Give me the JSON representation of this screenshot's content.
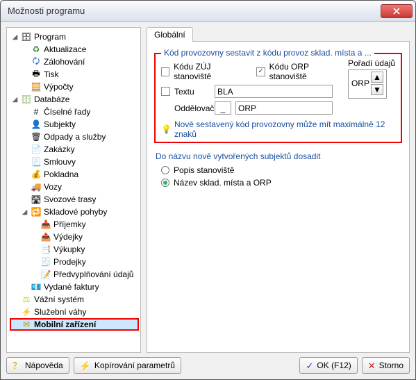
{
  "window": {
    "title": "Možnosti programu"
  },
  "tree": {
    "program": {
      "label": "Program",
      "items": {
        "aktualizace": "Aktualizace",
        "zalohovani": "Zálohování",
        "tisk": "Tisk",
        "vypocty": "Výpočty"
      }
    },
    "databaze": {
      "label": "Databáze",
      "items": {
        "ciselne_rady": "Číselné řady",
        "subjekty": "Subjekty",
        "odpady_sluzby": "Odpady a služby",
        "zakazky": "Zakázky",
        "smlouvy": "Smlouvy",
        "pokladna": "Pokladna",
        "vozy": "Vozy",
        "svozove_trasy": "Svozové trasy",
        "skladove_pohyby": {
          "label": "Skladové pohyby",
          "items": {
            "prijemky": "Příjemky",
            "vydejky": "Výdejky",
            "vykupky": "Výkupky",
            "prodejky": "Prodejky",
            "predvyplnovani": "Předvyplňování údajů"
          }
        },
        "vydane_faktury": "Vydané faktury"
      }
    },
    "vazni_system": "Vážní systém",
    "sluzebni_vahy": "Služební váhy",
    "mobilni_zarizeni": "Mobilní zařízení"
  },
  "tabs": {
    "global": "Globální"
  },
  "group1": {
    "legend": "Kód provozovny sestavit z kódu provoz sklad. místa a ...",
    "cb_zuj": "Kódu ZÚJ stanoviště",
    "cb_orp": "Kódu ORP stanoviště",
    "cb_textu": "Textu",
    "textu_value": "BLA",
    "oddelovac_label": "Oddělovač",
    "oddelovac_value": "_",
    "order_label": "Pořadí údajů",
    "order_item": "ORP",
    "preview": "ORP",
    "tip": "Nově sestavený kód provozovny může mít maximálně 12 znaků"
  },
  "group2": {
    "legend": "Do názvu nově vytvořených subjektů dosadit",
    "opt1": "Popis stanoviště",
    "opt2": "Název sklad. místa a ORP"
  },
  "buttons": {
    "help": "Nápověda",
    "copy_params": "Kopírování parametrů",
    "ok": "OK (F12)",
    "cancel": "Storno"
  },
  "icons": {
    "aktualizace": "♻",
    "zalohovani": "🗘",
    "tisk": "🖶",
    "vypocty": "🧮",
    "databaze": "🗄",
    "ciselne_rady": "#",
    "subjekty": "👤",
    "odpady_sluzby": "🗑",
    "zakazky": "📄",
    "smlouvy": "📃",
    "pokladna": "💰",
    "vozy": "🚚",
    "svozove_trasy": "🛣",
    "skladove_pohyby": "🔁",
    "prijemky": "📥",
    "vydejky": "📤",
    "vykupky": "📑",
    "prodejky": "🧾",
    "predvyplnovani": "📝",
    "vydane_faktury": "💶",
    "vazni_system": "⚖",
    "sluzebni_vahy": "⚡",
    "mobilni_zarizeni": "✉",
    "program": "🗄",
    "tip": "💡"
  }
}
